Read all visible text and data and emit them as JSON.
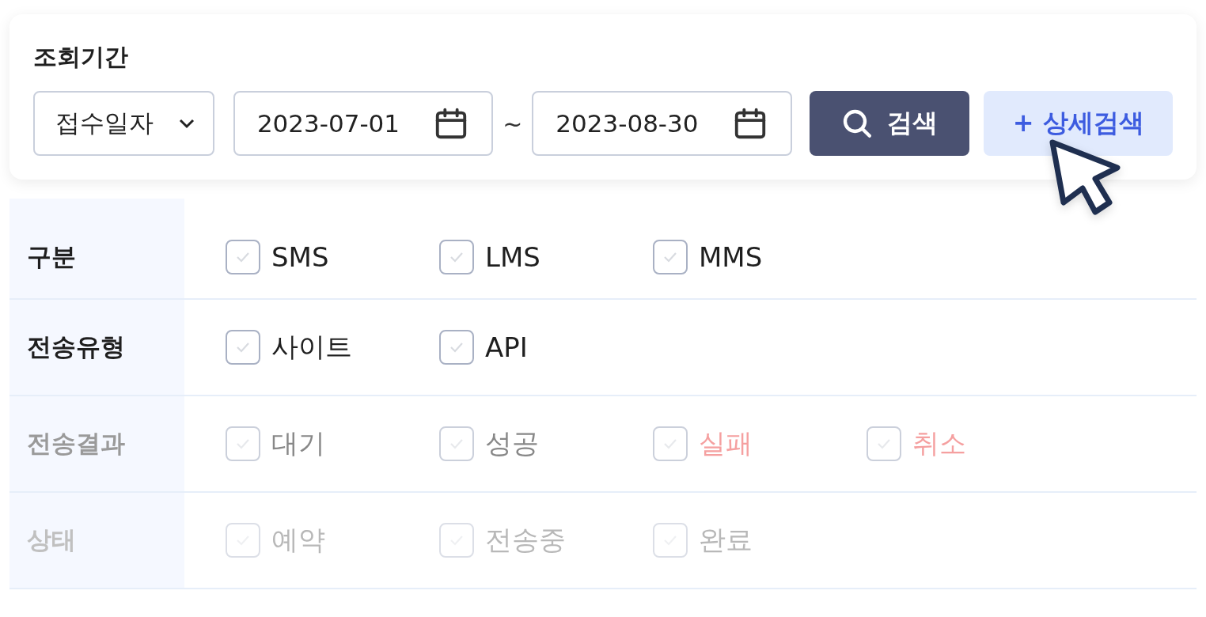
{
  "period": {
    "title": "조회기간",
    "date_type": "접수일자",
    "start_date": "2023-07-01",
    "separator": "~",
    "end_date": "2023-08-30",
    "search_button": "검색",
    "detail_button": "+ 상세검색"
  },
  "filters": [
    {
      "label": "구분",
      "disabled": false,
      "options": [
        {
          "label": "SMS",
          "checked": false,
          "color": "#1f1f1f"
        },
        {
          "label": "LMS",
          "checked": false,
          "color": "#1f1f1f"
        },
        {
          "label": "MMS",
          "checked": false,
          "color": "#1f1f1f"
        }
      ]
    },
    {
      "label": "전송유형",
      "disabled": false,
      "options": [
        {
          "label": "사이트",
          "checked": false,
          "color": "#1f1f1f"
        },
        {
          "label": "API",
          "checked": false,
          "color": "#1f1f1f"
        }
      ]
    },
    {
      "label": "전송결과",
      "disabled": true,
      "options": [
        {
          "label": "대기",
          "checked": false,
          "color": "#888888"
        },
        {
          "label": "성공",
          "checked": false,
          "color": "#888888"
        },
        {
          "label": "실패",
          "checked": false,
          "color": "#f5a0a0"
        },
        {
          "label": "취소",
          "checked": false,
          "color": "#f5a0a0"
        }
      ]
    },
    {
      "label": "상태",
      "disabled": true,
      "options": [
        {
          "label": "예약",
          "checked": false,
          "color": "#b8b8b8"
        },
        {
          "label": "전송중",
          "checked": false,
          "color": "#b8b8b8"
        },
        {
          "label": "완료",
          "checked": false,
          "color": "#b8b8b8"
        }
      ]
    }
  ]
}
